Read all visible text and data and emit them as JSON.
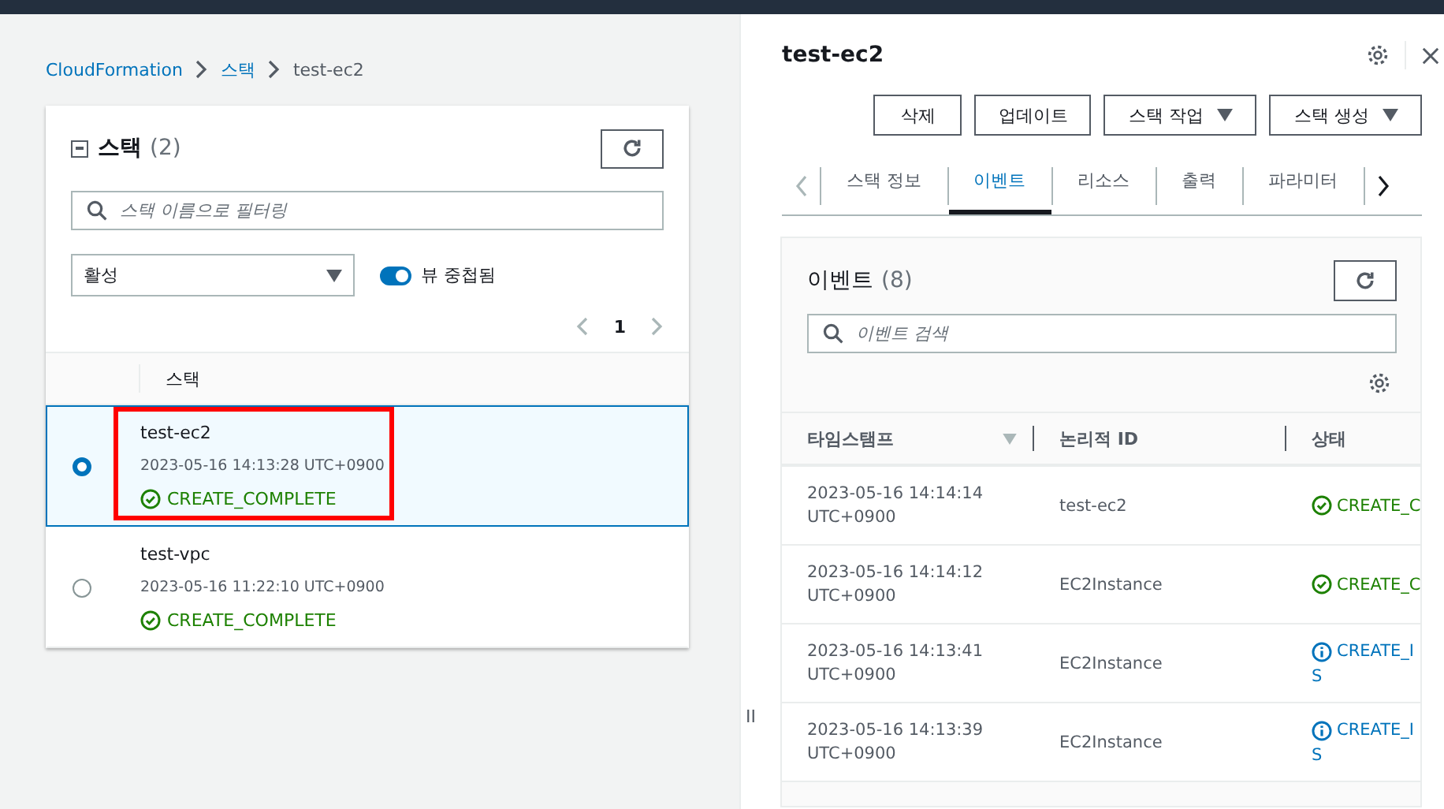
{
  "breadcrumb": [
    {
      "label": "CloudFormation",
      "link": true
    },
    {
      "label": "스택",
      "link": true
    },
    {
      "label": "test-ec2",
      "link": false
    }
  ],
  "stacks_panel": {
    "title": "스택",
    "count": "(2)",
    "search": {
      "placeholder": "스택 이름으로 필터링"
    },
    "filter": {
      "value": "활성"
    },
    "nested_toggle": {
      "label": "뷰 중첩됨",
      "on": true
    },
    "page": "1",
    "column": "스택",
    "rows": [
      {
        "name": "test-ec2",
        "time": "2023-05-16 14:13:28 UTC+0900",
        "status": "CREATE_COMPLETE",
        "kind": "success",
        "selected": true
      },
      {
        "name": "test-vpc",
        "time": "2023-05-16 11:22:10 UTC+0900",
        "status": "CREATE_COMPLETE",
        "kind": "success",
        "selected": false
      }
    ]
  },
  "detail_panel": {
    "title": "test-ec2",
    "buttons": [
      {
        "label": "삭제",
        "dropdown": false
      },
      {
        "label": "업데이트",
        "dropdown": false
      },
      {
        "label": "스택 작업",
        "dropdown": true
      },
      {
        "label": "스택 생성",
        "dropdown": true
      }
    ],
    "tabs": [
      {
        "label": "스택 정보",
        "selected": false
      },
      {
        "label": "이벤트",
        "selected": true
      },
      {
        "label": "리소스",
        "selected": false
      },
      {
        "label": "출력",
        "selected": false
      },
      {
        "label": "파라미터",
        "selected": false
      }
    ],
    "events": {
      "title": "이벤트",
      "count": "(8)",
      "search": {
        "placeholder": "이벤트 검색"
      },
      "columns": [
        "타임스탬프",
        "논리적 ID",
        "상태"
      ],
      "rows": [
        {
          "date": "2023-05-16 14:14:14",
          "zone": "UTC+0900",
          "logical_id": "test-ec2",
          "status": [
            "CREATE_C"
          ],
          "kind": "success"
        },
        {
          "date": "2023-05-16 14:14:12",
          "zone": "UTC+0900",
          "logical_id": "EC2Instance",
          "status": [
            "CREATE_C"
          ],
          "kind": "success"
        },
        {
          "date": "2023-05-16 14:13:41",
          "zone": "UTC+0900",
          "logical_id": "EC2Instance",
          "status": [
            "CREATE_I",
            "S"
          ],
          "kind": "info"
        },
        {
          "date": "2023-05-16 14:13:39",
          "zone": "UTC+0900",
          "logical_id": "EC2Instance",
          "status": [
            "CREATE_I",
            "S"
          ],
          "kind": "info"
        }
      ]
    }
  },
  "splitter": "II"
}
